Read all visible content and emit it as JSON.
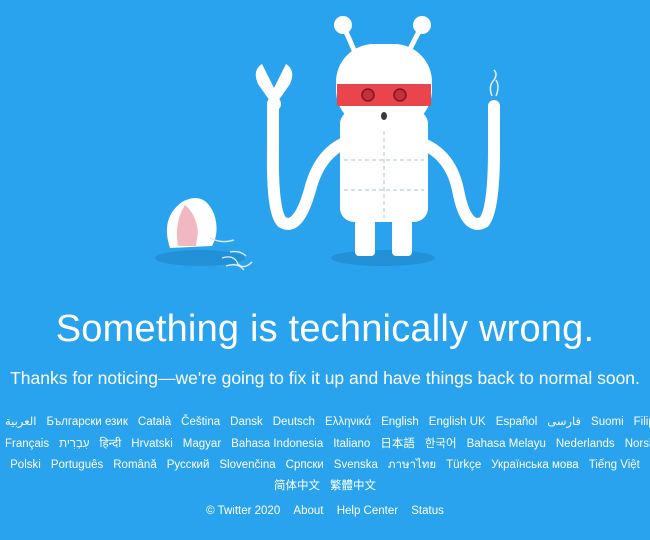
{
  "headline": "Something is technically wrong.",
  "subtext": "Thanks for noticing—we're going to fix it up and have things back to normal soon.",
  "languages": {
    "row1": [
      "العربية",
      "Български език",
      "Català",
      "Čeština",
      "Dansk",
      "Deutsch",
      "Ελληνικά",
      "English",
      "English UK",
      "Español",
      "فارسی",
      "Suomi",
      "Filipino"
    ],
    "row2": [
      "Français",
      "עִבְרִית",
      "हिन्दी",
      "Hrvatski",
      "Magyar",
      "Bahasa Indonesia",
      "Italiano",
      "日本語",
      "한국어",
      "Bahasa Melayu",
      "Nederlands",
      "Norsk"
    ],
    "row3": [
      "Polski",
      "Português",
      "Română",
      "Русский",
      "Slovenčina",
      "Српски",
      "Svenska",
      "ภาษาไทย",
      "Türkçe",
      "Українська мова",
      "Tiếng Việt"
    ],
    "row4": [
      "简体中文",
      "繁體中文"
    ]
  },
  "footer": {
    "copyright": "© Twitter 2020",
    "about": "About",
    "help_center": "Help Center",
    "status": "Status"
  },
  "colors": {
    "background": "#2aa3ef",
    "text": "#ffffff",
    "robot_mask": "#e8454c"
  }
}
